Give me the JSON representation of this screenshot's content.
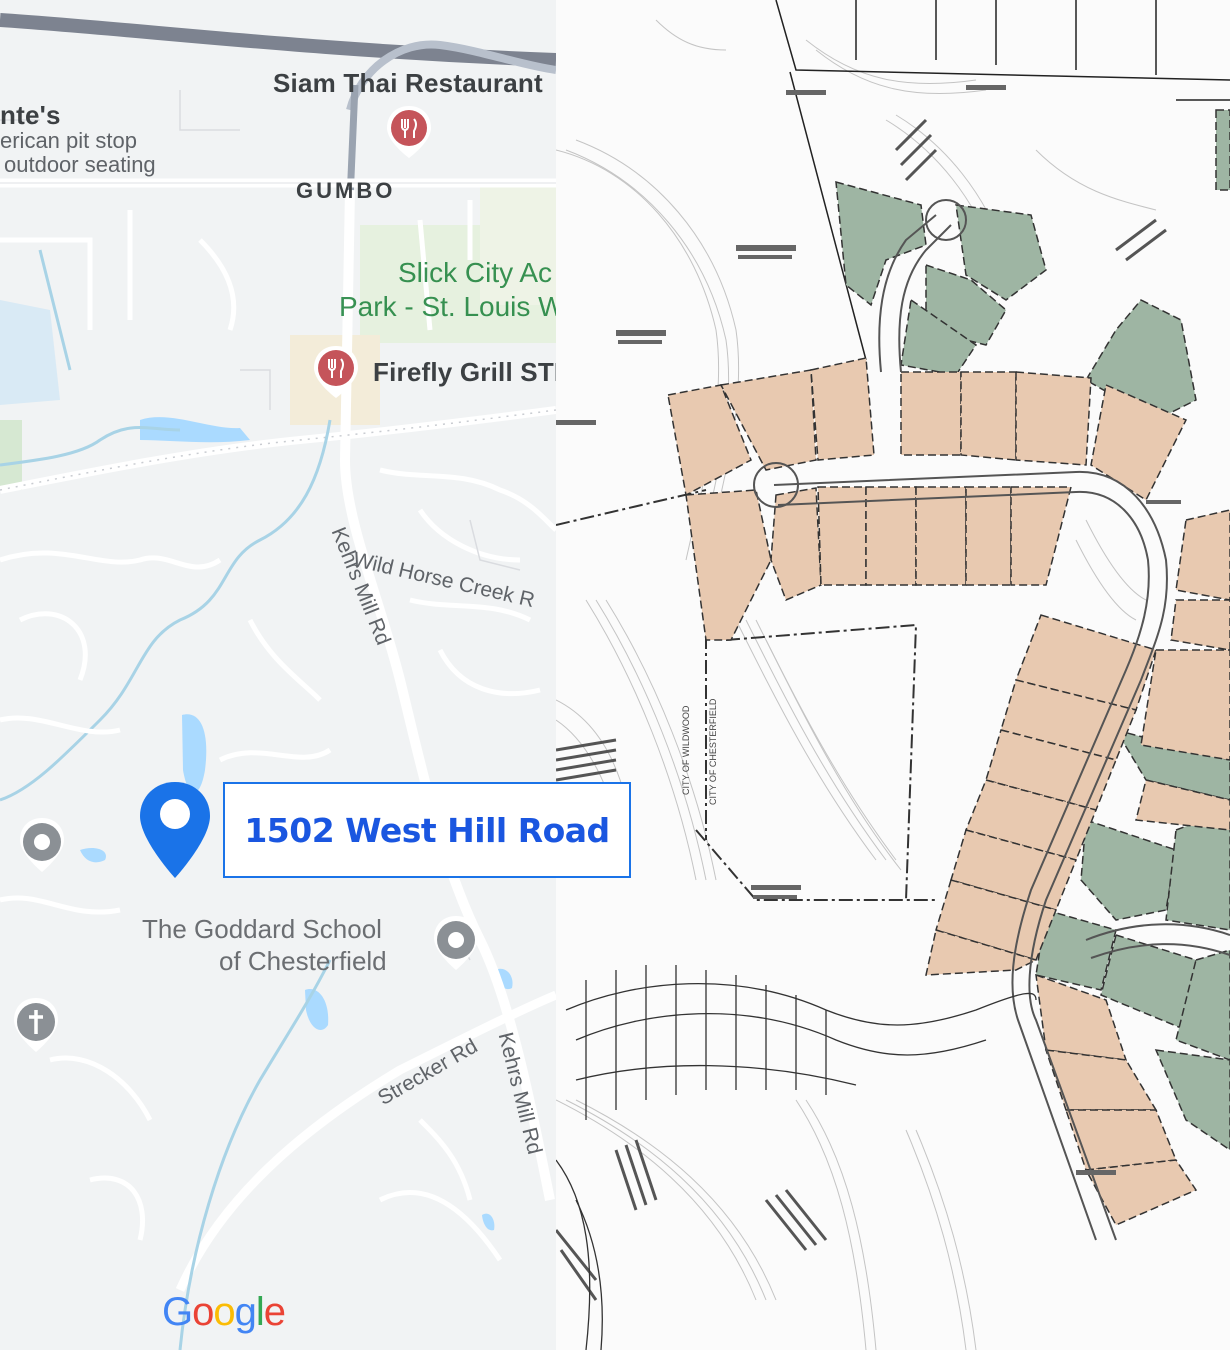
{
  "map": {
    "pois": {
      "siam_thai": "Siam Thai Restaurant",
      "partial_name": "nte's",
      "partial_desc_1": "erican pit stop",
      "partial_desc_2": "outdoor seating",
      "gumbo": "GUMBO",
      "slick_city_1": "Slick City Ac",
      "slick_city_2": "Park - St. Louis W",
      "firefly": "Firefly Grill STL",
      "goddard_1": "The Goddard School",
      "goddard_2": "of Chesterfield"
    },
    "roads": {
      "wild_horse": "Wild Horse Creek R",
      "kehrs_mill_1": "Kehrs Mill Rd",
      "kehrs_mill_2": "Kehrs Mill Rd",
      "strecker": "Strecker Rd"
    },
    "address_callout": "1502 West Hill Road",
    "google_logo": [
      "G",
      "o",
      "o",
      "g",
      "l",
      "e"
    ],
    "icons": {
      "restaurant": "restaurant-pin-icon",
      "school": "school-pin-icon",
      "church": "church-pin-icon",
      "location": "location-pin-icon"
    }
  },
  "plat": {
    "boundary_labels": {
      "wildwood": "CITY OF WILDWOOD",
      "chesterfield": "CITY OF CHESTERFIELD"
    }
  },
  "colors": {
    "map_bg": "#f1f3f4",
    "water": "#aadaff",
    "pin_blue": "#1a73e8",
    "lot_tan": "#e8c9b0",
    "lot_green": "#9eb5a3"
  }
}
